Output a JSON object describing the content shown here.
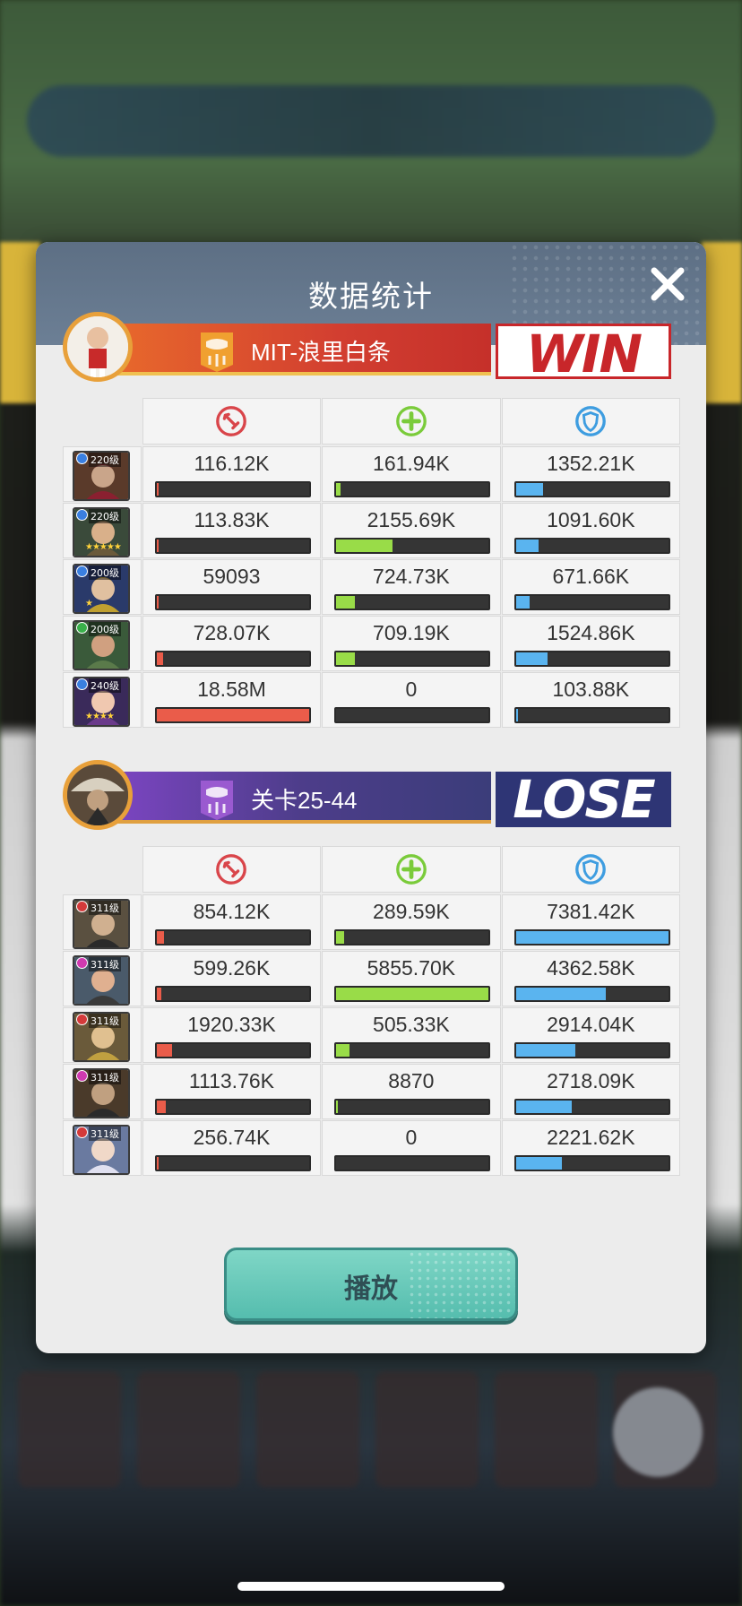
{
  "background": {
    "fab_label": ""
  },
  "modal": {
    "title": "数据统计",
    "play_label": "播放"
  },
  "colors": {
    "damage": "#ea5c4a",
    "heal": "#99dc48",
    "shield": "#5ab4ef"
  },
  "teams": [
    {
      "name": "MIT-浪里白条",
      "result": "WIN",
      "heroes": [
        {
          "level": "220级",
          "gem": "#3a7fe0",
          "stars": "",
          "stats": [
            {
              "value": "116.12K",
              "pct": 0.01
            },
            {
              "value": "161.94K",
              "pct": 0.03
            },
            {
              "value": "1352.21K",
              "pct": 0.18
            }
          ]
        },
        {
          "level": "220级",
          "gem": "#3a7fe0",
          "stars": "★★★★★",
          "stats": [
            {
              "value": "113.83K",
              "pct": 0.01
            },
            {
              "value": "2155.69K",
              "pct": 0.37
            },
            {
              "value": "1091.60K",
              "pct": 0.15
            }
          ]
        },
        {
          "level": "200级",
          "gem": "#3a7fe0",
          "stars": "★",
          "stats": [
            {
              "value": "59093",
              "pct": 0.005
            },
            {
              "value": "724.73K",
              "pct": 0.12
            },
            {
              "value": "671.66K",
              "pct": 0.09
            }
          ]
        },
        {
          "level": "200级",
          "gem": "#39b04a",
          "stars": "",
          "stats": [
            {
              "value": "728.07K",
              "pct": 0.04
            },
            {
              "value": "709.19K",
              "pct": 0.12
            },
            {
              "value": "1524.86K",
              "pct": 0.21
            }
          ]
        },
        {
          "level": "240级",
          "gem": "#3a7fe0",
          "stars": "★★★★",
          "stats": [
            {
              "value": "18.58M",
              "pct": 1.0
            },
            {
              "value": "0",
              "pct": 0
            },
            {
              "value": "103.88K",
              "pct": 0.014
            }
          ]
        }
      ]
    },
    {
      "name": "关卡25-44",
      "result": "LOSE",
      "heroes": [
        {
          "level": "311级",
          "gem": "#d43a3a",
          "stars": "",
          "stats": [
            {
              "value": "854.12K",
              "pct": 0.05
            },
            {
              "value": "289.59K",
              "pct": 0.05
            },
            {
              "value": "7381.42K",
              "pct": 1.0
            }
          ]
        },
        {
          "level": "311级",
          "gem": "#d03ab0",
          "stars": "",
          "stats": [
            {
              "value": "599.26K",
              "pct": 0.03
            },
            {
              "value": "5855.70K",
              "pct": 1.0
            },
            {
              "value": "4362.58K",
              "pct": 0.59
            }
          ]
        },
        {
          "level": "311级",
          "gem": "#d43a3a",
          "stars": "",
          "stats": [
            {
              "value": "1920.33K",
              "pct": 0.1
            },
            {
              "value": "505.33K",
              "pct": 0.09
            },
            {
              "value": "2914.04K",
              "pct": 0.39
            }
          ]
        },
        {
          "level": "311级",
          "gem": "#d03ab0",
          "stars": "",
          "stats": [
            {
              "value": "1113.76K",
              "pct": 0.06
            },
            {
              "value": "8870",
              "pct": 0.001
            },
            {
              "value": "2718.09K",
              "pct": 0.37
            }
          ]
        },
        {
          "level": "311级",
          "gem": "#d43a3a",
          "stars": "",
          "stats": [
            {
              "value": "256.74K",
              "pct": 0.014
            },
            {
              "value": "0",
              "pct": 0
            },
            {
              "value": "2221.62K",
              "pct": 0.3
            }
          ]
        }
      ]
    }
  ]
}
